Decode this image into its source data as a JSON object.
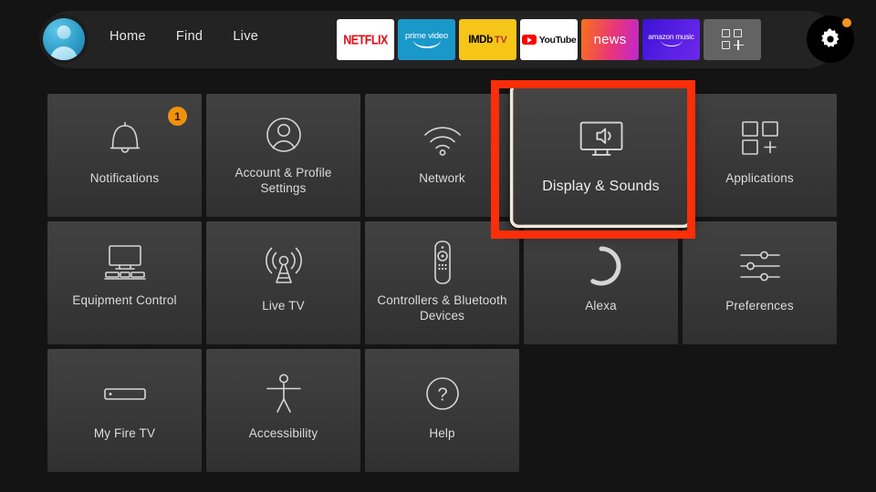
{
  "header": {
    "avatar": "profile-avatar",
    "nav": [
      {
        "label": "Home"
      },
      {
        "label": "Find"
      },
      {
        "label": "Live"
      }
    ],
    "apps": [
      {
        "name": "netflix",
        "label": "NETFLIX"
      },
      {
        "name": "prime-video",
        "label": "prime video"
      },
      {
        "name": "imdb-tv",
        "label": "IMDb",
        "label2": "TV"
      },
      {
        "name": "youtube",
        "label": "YouTube"
      },
      {
        "name": "news",
        "label": "news"
      },
      {
        "name": "amazon-music",
        "label": "amazon music"
      },
      {
        "name": "app-library",
        "label": ""
      }
    ],
    "settings_button": {
      "icon": "gear-icon",
      "has_notification_dot": true
    }
  },
  "grid": {
    "rows": [
      [
        {
          "label": "Notifications",
          "icon": "bell-icon",
          "badge": "1",
          "selected": false
        },
        {
          "label": "Account & Profile Settings",
          "icon": "user-circle-icon",
          "selected": false
        },
        {
          "label": "Network",
          "icon": "wifi-icon",
          "selected": false
        },
        {
          "label": "Display & Sounds",
          "icon": "tv-speaker-icon",
          "selected": true
        },
        {
          "label": "Applications",
          "icon": "app-squares-plus-icon",
          "selected": false
        }
      ],
      [
        {
          "label": "Equipment Control",
          "icon": "tv-stand-icon",
          "selected": false
        },
        {
          "label": "Live TV",
          "icon": "antenna-icon",
          "selected": false
        },
        {
          "label": "Controllers & Bluetooth Devices",
          "icon": "remote-icon",
          "selected": false
        },
        {
          "label": "Alexa",
          "icon": "alexa-ring-icon",
          "selected": false
        },
        {
          "label": "Preferences",
          "icon": "sliders-icon",
          "selected": false
        }
      ],
      [
        {
          "label": "My Fire TV",
          "icon": "fire-tv-stick-icon",
          "selected": false
        },
        {
          "label": "Accessibility",
          "icon": "accessibility-icon",
          "selected": false
        },
        {
          "label": "Help",
          "icon": "question-circle-icon",
          "selected": false
        }
      ]
    ]
  },
  "annotation": {
    "name": "highlight-rectangle",
    "color": "#fb2e09",
    "targets": "Display & Sounds"
  },
  "colors": {
    "background": "#141414",
    "tile": "#3a3a3a",
    "header_bar": "#232323",
    "badge": "#f0920f",
    "accent_red": "#fb2e09",
    "selected_border": "#efe8d8"
  }
}
